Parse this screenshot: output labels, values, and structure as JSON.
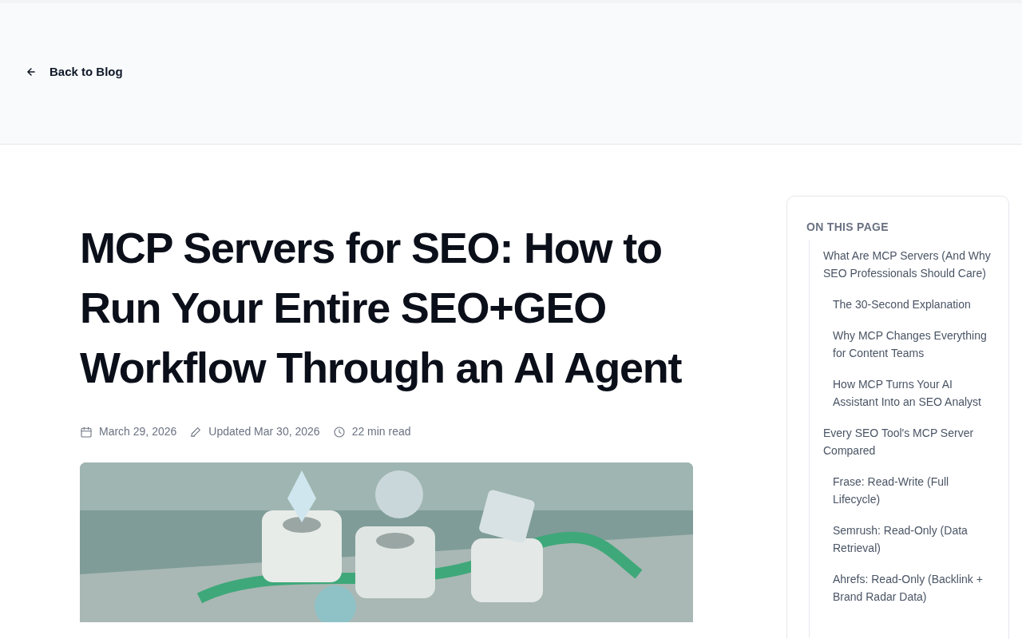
{
  "back_link": {
    "label": "Back to Blog"
  },
  "article": {
    "title": "MCP Servers for SEO: How to Run Your Entire SEO+GEO Workflow Through an AI Agent",
    "meta": [
      {
        "kind": "published",
        "text": "March 29, 2026"
      },
      {
        "kind": "updated",
        "text": "Updated Mar 30, 2026"
      },
      {
        "kind": "reading_time",
        "text": "22 min read"
      }
    ]
  },
  "toc": {
    "heading": "ON THIS PAGE",
    "items": [
      {
        "label": "What Are MCP Servers (And Why SEO Professionals Should Care)",
        "children": [
          {
            "label": "The 30-Second Explanation"
          },
          {
            "label": "Why MCP Changes Everything for Content Teams"
          },
          {
            "label": "How MCP Turns Your AI Assistant Into an SEO Analyst"
          }
        ]
      },
      {
        "label": "Every SEO Tool's MCP Server Compared",
        "children": [
          {
            "label": "Frase: Read-Write (Full Lifecycle)"
          },
          {
            "label": "Semrush: Read-Only (Data Retrieval)"
          },
          {
            "label": "Ahrefs: Read-Only (Backlink + Brand Radar Data)"
          }
        ]
      }
    ]
  }
}
